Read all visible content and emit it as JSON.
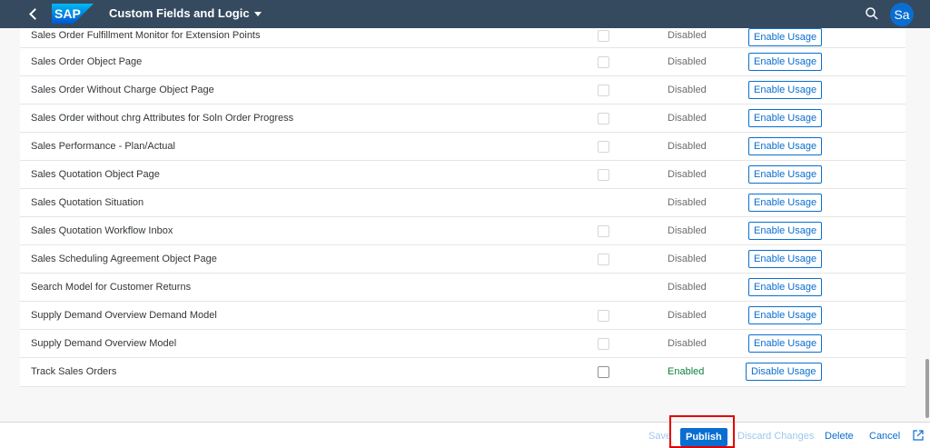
{
  "shellbar": {
    "logo_text": "SAP",
    "title": "Custom Fields and Logic",
    "avatar_initials": "Sa",
    "colors": {
      "background": "#354a5f",
      "accent": "#0a6ed1"
    }
  },
  "rows": [
    {
      "name": "Sales Order Fulfillment Monitor for Extension Points",
      "checkbox": true,
      "status": "Disabled",
      "action": "Enable Usage"
    },
    {
      "name": "Sales Order Object Page",
      "checkbox": true,
      "status": "Disabled",
      "action": "Enable Usage"
    },
    {
      "name": "Sales Order Without Charge Object Page",
      "checkbox": true,
      "status": "Disabled",
      "action": "Enable Usage"
    },
    {
      "name": "Sales Order without chrg Attributes for Soln Order Progress",
      "checkbox": true,
      "status": "Disabled",
      "action": "Enable Usage"
    },
    {
      "name": "Sales Performance - Plan/Actual",
      "checkbox": true,
      "status": "Disabled",
      "action": "Enable Usage"
    },
    {
      "name": "Sales Quotation Object Page",
      "checkbox": true,
      "status": "Disabled",
      "action": "Enable Usage"
    },
    {
      "name": "Sales Quotation Situation",
      "checkbox": false,
      "status": "Disabled",
      "action": "Enable Usage"
    },
    {
      "name": "Sales Quotation Workflow Inbox",
      "checkbox": true,
      "status": "Disabled",
      "action": "Enable Usage"
    },
    {
      "name": "Sales Scheduling Agreement Object Page",
      "checkbox": true,
      "status": "Disabled",
      "action": "Enable Usage"
    },
    {
      "name": "Search Model for Customer Returns",
      "checkbox": false,
      "status": "Disabled",
      "action": "Enable Usage"
    },
    {
      "name": "Supply Demand Overview Demand Model",
      "checkbox": true,
      "status": "Disabled",
      "action": "Enable Usage"
    },
    {
      "name": "Supply Demand Overview Model",
      "checkbox": true,
      "status": "Disabled",
      "action": "Enable Usage"
    },
    {
      "name": "Track Sales Orders",
      "checkbox": true,
      "status": "Enabled",
      "action": "Disable Usage"
    }
  ],
  "footer": {
    "save": "Save",
    "publish": "Publish",
    "discard": "Discard Changes",
    "delete": "Delete",
    "cancel": "Cancel"
  },
  "icons": {
    "back": "back-arrow-icon",
    "search": "search-icon",
    "share": "share-icon"
  }
}
